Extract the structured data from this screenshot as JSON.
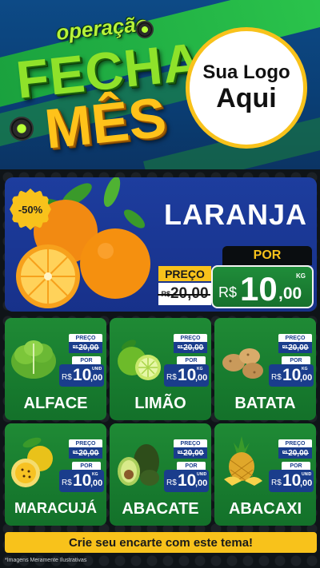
{
  "header": {
    "title_top": "operação",
    "title_mid": "FECHA",
    "title_bottom": "MÊS",
    "logo_line1": "Sua Logo",
    "logo_line2": "Aqui"
  },
  "hero": {
    "discount": "-50%",
    "name": "LARANJA",
    "price_label": "PREÇO",
    "old_currency": "R$",
    "old_price": "20,00",
    "por_label": "POR",
    "new_currency": "R$",
    "new_int": "10",
    "new_dec": ",00",
    "unit": "KG"
  },
  "products": [
    {
      "name": "ALFACE",
      "price_label": "PREÇO",
      "old_currency": "R$",
      "old_price": "20,00",
      "por_label": "POR",
      "currency": "R$",
      "int": "10",
      "dec": ",00",
      "unit": "UNID"
    },
    {
      "name": "LIMÃO",
      "price_label": "PREÇO",
      "old_currency": "R$",
      "old_price": "20,00",
      "por_label": "POR",
      "currency": "R$",
      "int": "10",
      "dec": ",00",
      "unit": "KG"
    },
    {
      "name": "BATATA",
      "price_label": "PREÇO",
      "old_currency": "R$",
      "old_price": "20,00",
      "por_label": "POR",
      "currency": "R$",
      "int": "10",
      "dec": ",00",
      "unit": "KG"
    },
    {
      "name": "MARACUJÁ",
      "price_label": "PREÇO",
      "old_currency": "R$",
      "old_price": "20,00",
      "por_label": "POR",
      "currency": "R$",
      "int": "10",
      "dec": ",00",
      "unit": "KG"
    },
    {
      "name": "ABACATE",
      "price_label": "PREÇO",
      "old_currency": "R$",
      "old_price": "20,00",
      "por_label": "POR",
      "currency": "R$",
      "int": "10",
      "dec": ",00",
      "unit": "UNID"
    },
    {
      "name": "ABACAXI",
      "price_label": "PREÇO",
      "old_currency": "R$",
      "old_price": "20,00",
      "por_label": "POR",
      "currency": "R$",
      "int": "10",
      "dec": ",00",
      "unit": "UNID"
    }
  ],
  "footer": {
    "cta": "Crie seu encarte com este tema!",
    "disclaimer": "*Imagens Meramente Ilustrativas"
  },
  "colors": {
    "header_blue": "#0d4a86",
    "accent_green": "#1f8a35",
    "accent_yellow": "#f8c21b",
    "price_blue": "#1a3d8c"
  },
  "icons": [
    "orange-icon",
    "lettuce-icon",
    "lime-icon",
    "potato-icon",
    "passion-fruit-icon",
    "avocado-icon",
    "pineapple-icon"
  ]
}
